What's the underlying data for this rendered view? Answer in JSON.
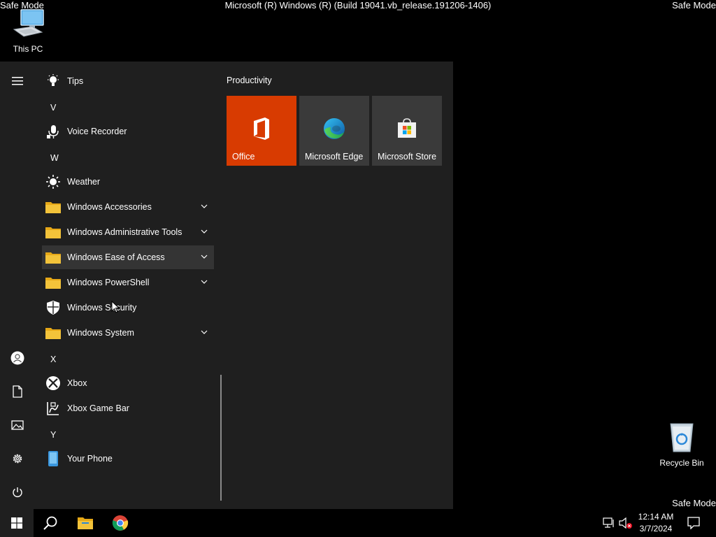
{
  "overlay": {
    "safe_mode": "Safe Mode",
    "build": "Microsoft (R) Windows (R) (Build 19041.vb_release.191206-1406)"
  },
  "desktop": {
    "this_pc": "This PC",
    "recycle_bin": "Recycle Bin"
  },
  "app_list": {
    "tips": "Tips",
    "letter_v": "V",
    "voice_recorder": "Voice Recorder",
    "letter_w": "W",
    "weather": "Weather",
    "win_accessories": "Windows Accessories",
    "win_admin_tools": "Windows Administrative Tools",
    "win_ease": "Windows Ease of Access",
    "win_powershell": "Windows PowerShell",
    "win_security": "Windows Security",
    "win_system": "Windows System",
    "letter_x": "X",
    "xbox": "Xbox",
    "xbox_game_bar": "Xbox Game Bar",
    "letter_y": "Y",
    "your_phone": "Your Phone"
  },
  "tiles": {
    "group": "Productivity",
    "office": "Office",
    "edge": "Microsoft Edge",
    "store": "Microsoft Store"
  },
  "clock": {
    "time": "12:14 AM",
    "date": "3/7/2024"
  },
  "colors": {
    "office_tile": "#d83b01",
    "tile_bg": "#3a3a3a",
    "folder": "#f3c33a",
    "start_bg": "#1f1f1f"
  }
}
